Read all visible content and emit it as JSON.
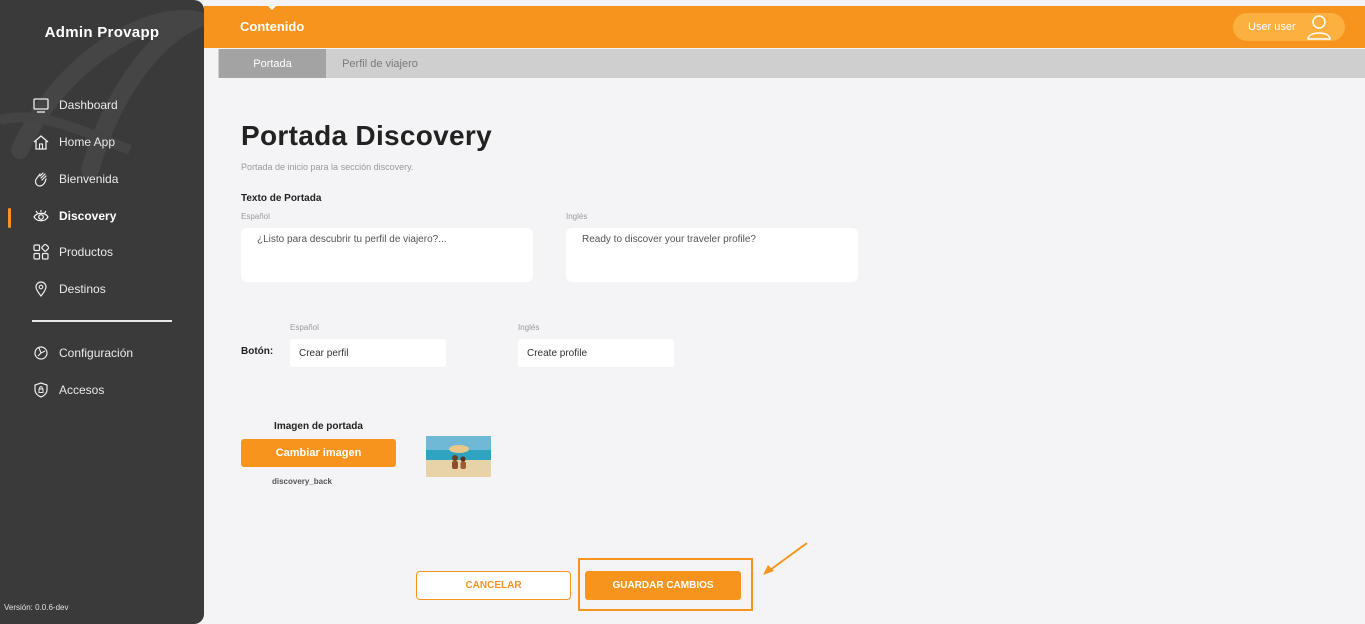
{
  "app": {
    "brand": "Admin Provapp",
    "version": "Versión: 0.0.6-dev"
  },
  "sidebar": {
    "items": [
      {
        "label": "Dashboard",
        "icon": "monitor-icon"
      },
      {
        "label": "Home App",
        "icon": "home-icon"
      },
      {
        "label": "Bienvenida",
        "icon": "wave-hand-icon"
      },
      {
        "label": "Discovery",
        "icon": "eye-icon",
        "active": true
      },
      {
        "label": "Productos",
        "icon": "grid-icon"
      },
      {
        "label": "Destinos",
        "icon": "location-pin-icon"
      }
    ],
    "bottom_items": [
      {
        "label": "Configuración",
        "icon": "settings-icon"
      },
      {
        "label": "Accesos",
        "icon": "shield-icon"
      }
    ]
  },
  "header": {
    "title": "Contenido",
    "user": "User user"
  },
  "tabs": [
    {
      "label": "Portada",
      "active": true
    },
    {
      "label": "Perfil de viajero",
      "active": false
    }
  ],
  "page": {
    "title": "Portada Discovery",
    "subtitle": "Portada de inicio para la sección discovery.",
    "cover_text": {
      "heading": "Texto de Portada",
      "es_label": "Español",
      "en_label": "Inglés",
      "es_value": "¿Listo para descubrir tu perfil de viajero?...",
      "en_value": "Ready to discover your traveler profile?"
    },
    "button": {
      "label": "Botón:",
      "es_label": "Español",
      "en_label": "Inglés",
      "es_value": "Crear perfil",
      "en_value": "Create profile"
    },
    "image": {
      "heading": "Imagen de portada",
      "change_label": "Cambiar imagen",
      "file_name": "discovery_back"
    },
    "actions": {
      "cancel": "CANCELAR",
      "save": "GUARDAR CAMBIOS"
    }
  },
  "colors": {
    "accent": "#f7941d",
    "sidebar": "#3a3a3a",
    "background": "#f4f4f6"
  }
}
